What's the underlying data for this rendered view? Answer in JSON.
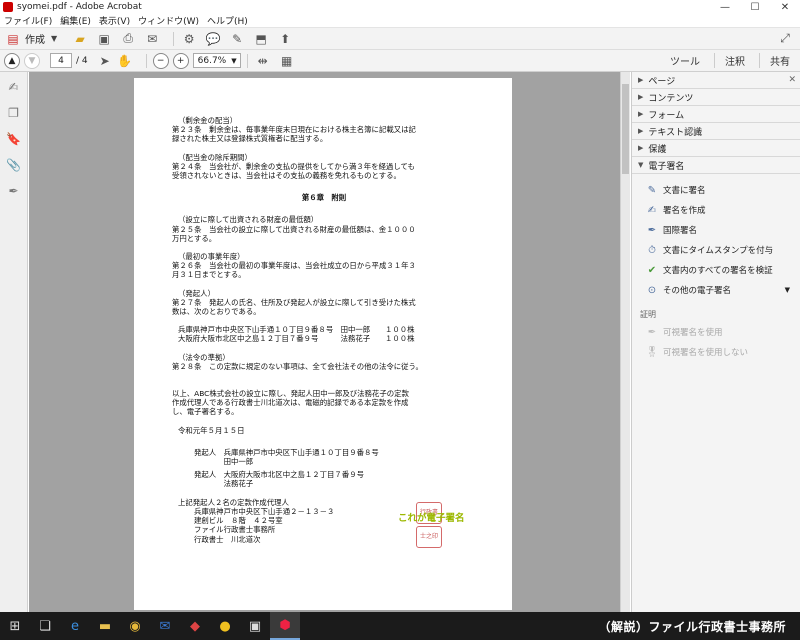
{
  "window": {
    "title": "syomei.pdf - Adobe Acrobat",
    "controls": [
      "—",
      "☐",
      "✕"
    ]
  },
  "menu": [
    "ファイル(F)",
    "編集(E)",
    "表示(V)",
    "ウィンドウ(W)",
    "ヘルプ(H)"
  ],
  "toolbar": {
    "create_label": "作成"
  },
  "nav": {
    "current_page": "4",
    "total_pages": "/ 4",
    "zoom": "66.7%",
    "tools_link": "ツール",
    "comment_link": "注釈",
    "share_link": "共有"
  },
  "document": {
    "lines_a": [
      "（剰余金の配当）",
      "第２３条　剰余金は、毎事業年度末日現在における株主名簿に記載又は記",
      "録された株主又は登録株式質権者に配当する。"
    ],
    "lines_b": [
      "（配当金の除斥期間）",
      "第２４条　当会社が、剰余金の支払の提供をしてから満３年を経過しても",
      "受領されないときは、当会社はその支払の義務を免れるものとする。"
    ],
    "chapter": "第６章　附則",
    "lines_c": [
      "（設立に際して出資される財産の最低額）",
      "第２５条　当会社の設立に際して出資される財産の最低額は、金１０００",
      "万円とする。"
    ],
    "lines_d": [
      "（最初の事業年度）",
      "第２６条　当会社の最初の事業年度は、当会社成立の日から平成３１年３",
      "月３１日までとする。"
    ],
    "lines_e": [
      "（発起人）",
      "第２７条　発起人の氏名、住所及び発起人が設立に際して引き受けた株式",
      "数は、次のとおりである。"
    ],
    "holders": [
      "兵庫県神戸市中央区下山手通１０丁目９番８号　田中一郎　　１００株",
      "大阪府大阪市北区中之島１２丁目７番９号　　　法務花子　　１００株"
    ],
    "lines_f": [
      "（法令の準拠）",
      "第２８条　この定款に規定のない事項は、全て会社法その他の法令に従う。"
    ],
    "closing": [
      "以上、ABC株式会社の設立に際し、発起人田中一郎及び法務花子の定款",
      "作成代理人である行政書士川北道次は、電磁的記録である本定款を作成",
      "し、電子署名する。"
    ],
    "date": "令和元年５月１５日",
    "founder1": [
      "発起人　兵庫県神戸市中央区下山手通１０丁目９番８号",
      "　　　　田中一郎"
    ],
    "founder2": [
      "発起人　大阪府大阪市北区中之島１２丁目７番９号",
      "　　　　法務花子"
    ],
    "agent_intro": "上記発起人２名の定款作成代理人",
    "agent": [
      "兵庫県神戸市中央区下山手通２－１３－３",
      "建創ビル　８階　４２号室",
      "ファイル行政書士事務所",
      "行政書士　川北道次"
    ],
    "seal_top": "行政書",
    "seal_bottom": "士之印",
    "signature_note": "これが電子署名"
  },
  "panel": {
    "sections": [
      "ページ",
      "コンテンツ",
      "フォーム",
      "テキスト認識",
      "保護",
      "電子署名"
    ],
    "sign_items": [
      "文書に署名",
      "署名を作成",
      "国際署名",
      "文書にタイムスタンプを付与",
      "文書内のすべての署名を検証",
      "その他の電子署名"
    ],
    "cert_label": "証明",
    "cert_items": [
      "可視署名を使用",
      "可視署名を使用しない"
    ]
  },
  "taskbar": {
    "brand": "（解説）ファイル行政書士事務所"
  },
  "colors": {
    "signature_note": "#9cb800",
    "seal": "#c85858"
  }
}
